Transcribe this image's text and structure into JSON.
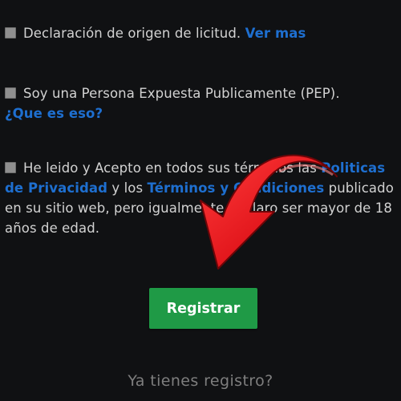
{
  "form": {
    "origin": {
      "text": "Declaración de origen de licitud.",
      "link": "Ver mas"
    },
    "pep": {
      "text": "Soy una Persona Expuesta Publicamente (PEP).",
      "link": "¿Que es eso?"
    },
    "terms": {
      "text_before": "He leido y Acepto en todos sus términos las",
      "privacy_link": "Politicas de Privacidad",
      "and": "y los",
      "terms_link": "Términos y Condiciones",
      "text_after": "publicado en su sitio web, pero igualmente declaro ser mayor de 18 años de edad."
    },
    "register_label": "Registrar",
    "already_registered": "Ya tienes registro?"
  },
  "colors": {
    "background": "#101113",
    "link": "#1e6fd0",
    "button": "#1f9a46",
    "arrow": "#e0141a"
  },
  "icons": {
    "arrow": "red-arrow-pointing-down-left"
  }
}
